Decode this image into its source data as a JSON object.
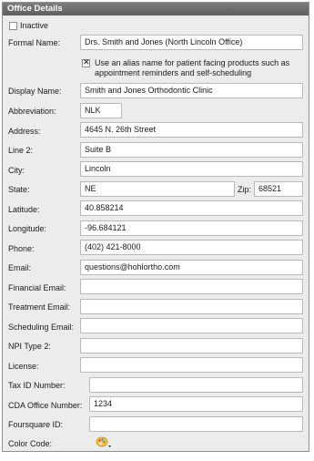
{
  "title": "Office Details",
  "inactive": {
    "label": "Inactive",
    "checked": false
  },
  "formal_name": {
    "label": "Formal Name:",
    "value": "Drs. Smith and Jones (North Lincoln Office)"
  },
  "alias": {
    "checked": true,
    "label": "Use an alias name for patient facing products such as appointment reminders and self-scheduling"
  },
  "display_name": {
    "label": "Display Name:",
    "value": "Smith and Jones Orthodontic Clinic"
  },
  "abbreviation": {
    "label": "Abbreviation:",
    "value": "NLK"
  },
  "address": {
    "label": "Address:",
    "value": "4645 N. 26th Street"
  },
  "line2": {
    "label": "Line 2:",
    "value": "Suite B"
  },
  "city": {
    "label": "City:",
    "value": "Lincoln"
  },
  "state": {
    "label": "State:",
    "value": "NE"
  },
  "zip": {
    "label": "Zip:",
    "value": "68521"
  },
  "latitude": {
    "label": "Latitude:",
    "value": "40.858214"
  },
  "longitude": {
    "label": "Longitude:",
    "value": "-96.684121"
  },
  "phone": {
    "label": "Phone:",
    "value": "(402) 421-8000"
  },
  "email": {
    "label": "Email:",
    "value": "questions@hohlortho.com"
  },
  "financial_email": {
    "label": "Financial Email:",
    "value": ""
  },
  "treatment_email": {
    "label": "Treatment Email:",
    "value": ""
  },
  "scheduling_email": {
    "label": "Scheduling Email:",
    "value": ""
  },
  "npi_type2": {
    "label": "NPI Type 2:",
    "value": ""
  },
  "license": {
    "label": "License:",
    "value": ""
  },
  "tax_id": {
    "label": "Tax ID Number:",
    "value": ""
  },
  "cda_office_number": {
    "label": "CDA Office Number:",
    "value": "1234"
  },
  "foursquare_id": {
    "label": "Foursquare ID:",
    "value": ""
  },
  "color_code": {
    "label": "Color Code:",
    "icon": "palette-icon"
  }
}
